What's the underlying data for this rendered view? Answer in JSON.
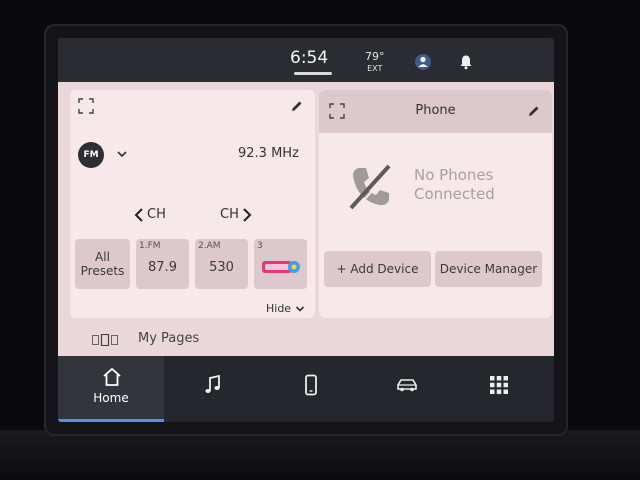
{
  "status": {
    "time": "6:54",
    "temperature": "79°",
    "temperature_label": "EXT"
  },
  "radio": {
    "band": "FM",
    "frequency": "92.3 MHz",
    "ch_prev": "CH",
    "ch_next": "CH",
    "all_presets": "All Presets",
    "presets": [
      {
        "number": "1.FM",
        "value": "87.9"
      },
      {
        "number": "2.AM",
        "value": "530"
      },
      {
        "number": "3",
        "value": ""
      }
    ],
    "hide_label": "Hide"
  },
  "phone": {
    "title": "Phone",
    "message": "No Phones Connected",
    "add_device": "+ Add Device",
    "device_manager": "Device Manager"
  },
  "my_pages": {
    "label": "My Pages"
  },
  "nav": {
    "home_label": "Home",
    "items": [
      "home-icon",
      "music-note-icon",
      "phone-icon",
      "car-icon",
      "apps-grid-icon"
    ]
  },
  "colors": {
    "accent": "#5a8fd6",
    "panel": "#f6e8eb",
    "tile": "#dcc8cd"
  }
}
